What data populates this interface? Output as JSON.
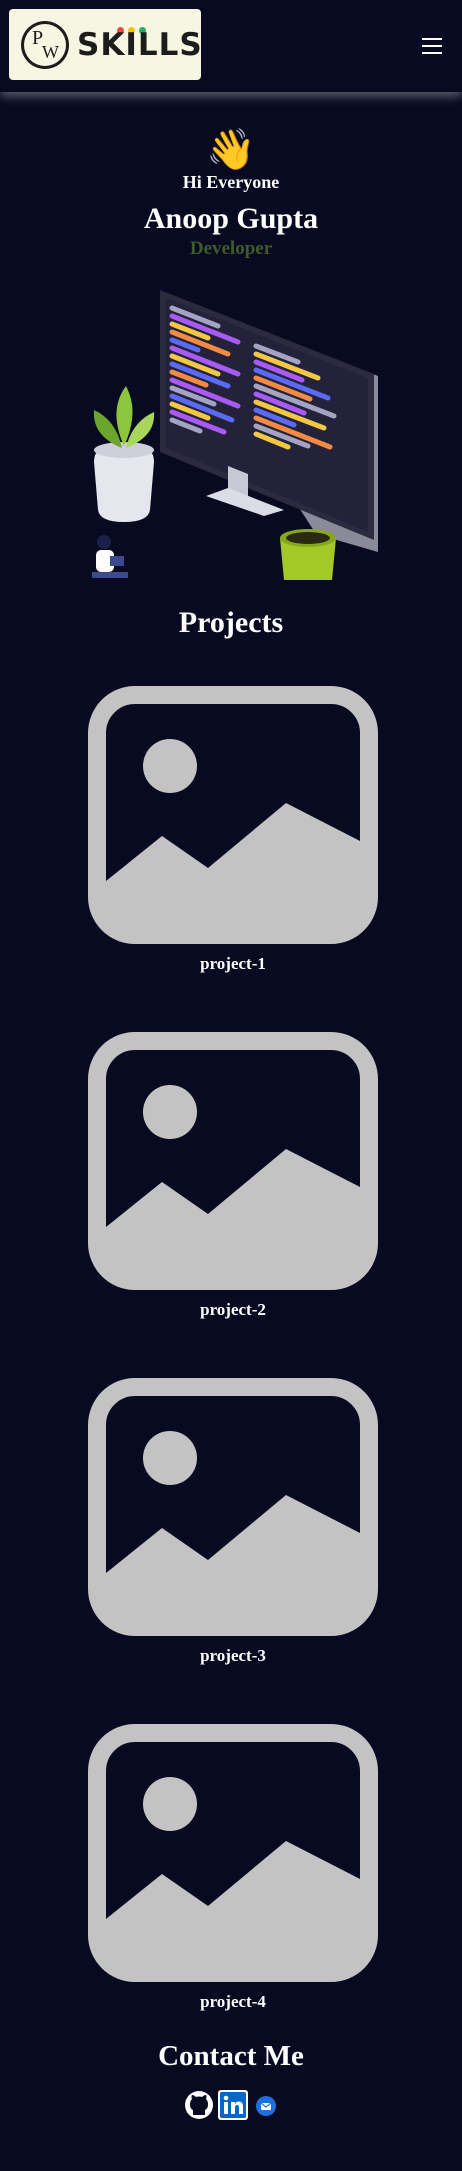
{
  "header": {
    "logo": {
      "monogram": "PW",
      "wordmark": "SKILLS"
    }
  },
  "hero": {
    "wave_icon": "waving-hand-icon",
    "greeting": "Hi Everyone",
    "name": "Anoop Gupta",
    "role": "Developer",
    "illustration": "developer-workspace-illustration"
  },
  "projects": {
    "title": "Projects",
    "items": [
      {
        "label": "project-1",
        "image": "image-placeholder-icon"
      },
      {
        "label": "project-2",
        "image": "image-placeholder-icon"
      },
      {
        "label": "project-3",
        "image": "image-placeholder-icon"
      },
      {
        "label": "project-4",
        "image": "image-placeholder-icon"
      }
    ]
  },
  "contact": {
    "title": "Contact Me",
    "links": [
      {
        "name": "github-icon"
      },
      {
        "name": "linkedin-icon"
      },
      {
        "name": "email-icon"
      }
    ]
  },
  "colors": {
    "background": "#080a22",
    "role_text": "#3f5a2b",
    "placeholder": "#c3c3c3",
    "logo_bg": "#f6f6e2"
  }
}
